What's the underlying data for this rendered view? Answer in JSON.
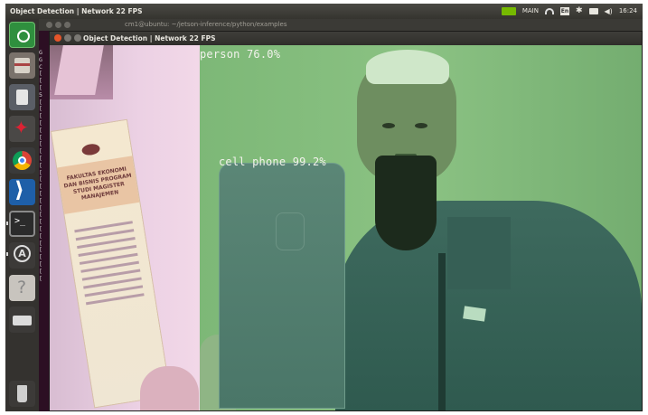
{
  "topbar": {
    "title": "Object Detection | Network 22 FPS",
    "tray": {
      "keyboard": "En",
      "clock": "16:24",
      "user": "MAIN"
    }
  },
  "launcher": {
    "items": [
      {
        "name": "ubuntu-home",
        "icon": "ubuntu-logo-icon"
      },
      {
        "name": "files",
        "icon": "file-cabinet-icon"
      },
      {
        "name": "trash",
        "icon": "trash-can-icon"
      },
      {
        "name": "settings",
        "icon": "settings-tools-icon"
      },
      {
        "name": "chromium",
        "icon": "chromium-browser-icon"
      },
      {
        "name": "vscode",
        "icon": "vscode-icon"
      },
      {
        "name": "terminal",
        "icon": "terminal-icon"
      },
      {
        "name": "software-updater",
        "icon": "software-updater-icon"
      },
      {
        "name": "help",
        "icon": "help-icon"
      },
      {
        "name": "drive",
        "icon": "removable-drive-icon"
      },
      {
        "name": "trash-bin",
        "icon": "trash-bin-icon"
      }
    ]
  },
  "terminal": {
    "title": "cm1@ubuntu: ~/jetson-inference/python/examples",
    "left_chars": [
      "G",
      "G",
      "C",
      "[",
      "[",
      "[",
      "5",
      "[",
      "[",
      "[",
      "[",
      "[",
      "[",
      "[",
      "[",
      "[",
      "[",
      "[",
      "[",
      "[",
      "[",
      "[",
      "[",
      "[",
      "[",
      "[",
      "[",
      "[",
      "[",
      "[",
      "[",
      "[",
      "["
    ]
  },
  "window": {
    "title": "Object Detection | Network 22 FPS",
    "detections": [
      {
        "label": "person",
        "confidence": "76.0%",
        "color": "#6cbf62"
      },
      {
        "label": "cell phone",
        "confidence": "99.2%",
        "color": "#4f7b6d"
      }
    ]
  },
  "poster": {
    "text": "FAKULTAS EKONOMI DAN BISNIS PROGRAM STUDI MAGISTER MANAJEMEN"
  }
}
